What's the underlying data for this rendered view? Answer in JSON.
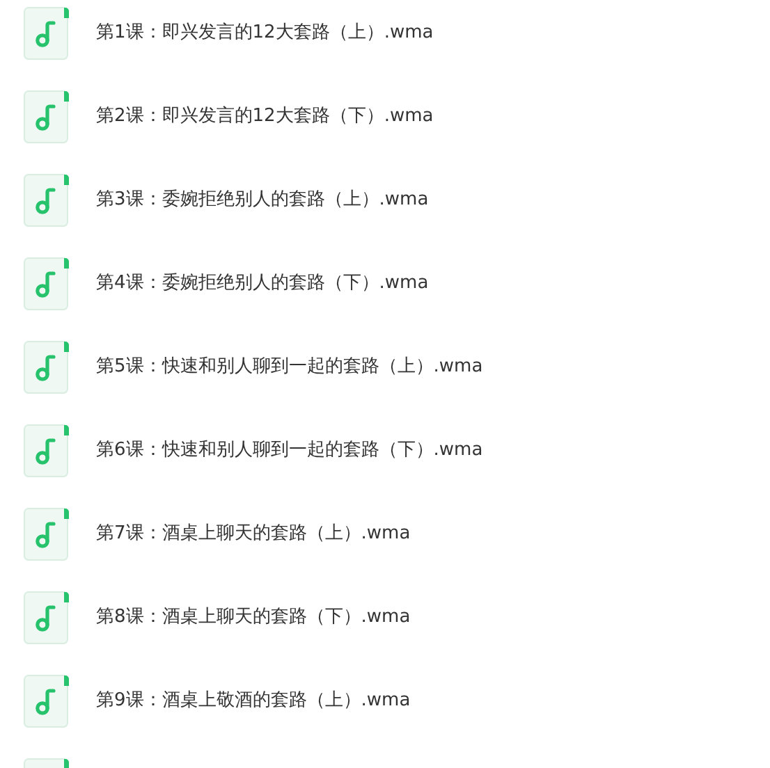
{
  "files": [
    {
      "name": "第1课：即兴发言的12大套路（上）.wma"
    },
    {
      "name": "第2课：即兴发言的12大套路（下）.wma"
    },
    {
      "name": "第3课：委婉拒绝别人的套路（上）.wma"
    },
    {
      "name": "第4课：委婉拒绝别人的套路（下）.wma"
    },
    {
      "name": "第5课：快速和别人聊到一起的套路（上）.wma"
    },
    {
      "name": "第6课：快速和别人聊到一起的套路（下）.wma"
    },
    {
      "name": "第7课：酒桌上聊天的套路（上）.wma"
    },
    {
      "name": "第8课：酒桌上聊天的套路（下）.wma"
    },
    {
      "name": "第9课：酒桌上敬酒的套路（上）.wma"
    }
  ]
}
